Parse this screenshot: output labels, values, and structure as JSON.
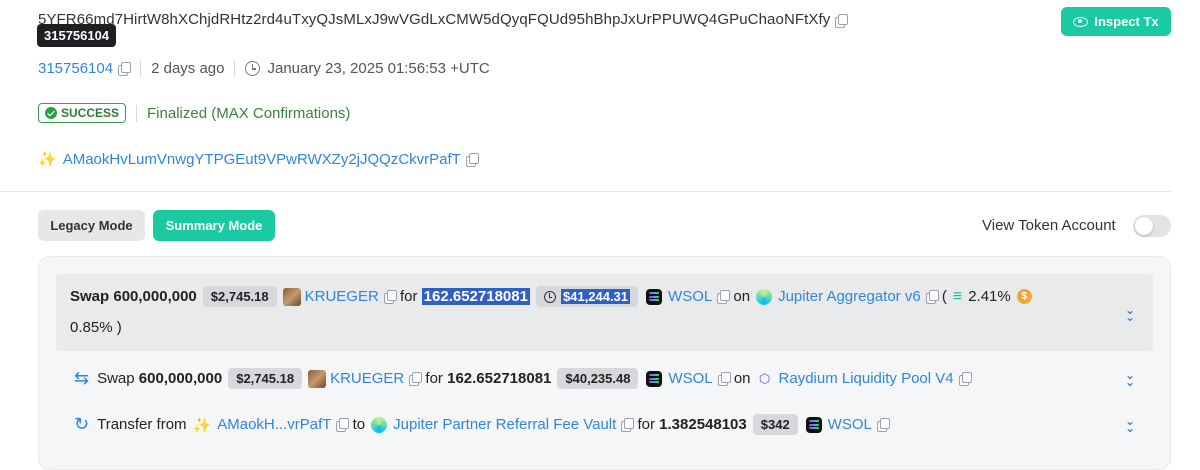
{
  "signature": "5YFR66md7HirtW8hXChjdRHtz2rd4uTxyQJsMLxJ9wVGdLxCMW5dQyqFQUd95hBhpJxUrPPUWQ4GPuChaoNFtXfy",
  "tooltip": "315756104",
  "inspect_label": "Inspect Tx",
  "block": "315756104",
  "relative_time": "2 days ago",
  "timestamp": "January 23, 2025 01:56:53 +UTC",
  "status": {
    "badge": "SUCCESS",
    "text": "Finalized (MAX Confirmations)"
  },
  "signer": "AMaokHvLumVnwgYTPGEut9VPwRWXZy2jJQQzCkvrPafT",
  "modes": {
    "legacy": "Legacy Mode",
    "summary": "Summary Mode"
  },
  "view_token_account": {
    "label": "View Token Account",
    "enabled": false
  },
  "actions": [
    {
      "verb": "Swap",
      "amount_in": "600,000,000",
      "value_in": "$2,745.18",
      "token_in": "KRUEGER",
      "for": "for",
      "amount_out": "162.652718081",
      "value_out": "$41,244.31",
      "token_out": "WSOL",
      "on": "on",
      "venue": "Jupiter Aggregator v6",
      "paren_open": "(",
      "fee1": "2.41%",
      "fee2": "0.85% )"
    },
    {
      "verb": "Swap",
      "amount_in": "600,000,000",
      "value_in": "$2,745.18",
      "token_in": "KRUEGER",
      "for": "for",
      "amount_out": "162.652718081",
      "value_out": "$40,235.48",
      "token_out": "WSOL",
      "on": "on",
      "venue": "Raydium Liquidity Pool V4"
    },
    {
      "verb": "Transfer from",
      "from": "AMaokH...vrPafT",
      "to_label": "to",
      "to": "Jupiter Partner Referral Fee Vault",
      "for": "for",
      "amount": "1.382548103",
      "value": "$342",
      "token": "WSOL"
    }
  ],
  "icons": {
    "copy": "copy-icon",
    "eye": "eye-icon",
    "clock": "clock-icon",
    "check": "check-circle-icon",
    "signer": "signer-icon",
    "swap": "swap-arrows-icon",
    "transfer": "transfer-icon",
    "expand": "chevron-double-down-icon"
  },
  "colors": {
    "accent": "#1bc9a3",
    "link": "#2f86d9",
    "success": "#2e7d32",
    "selection": "#3060c4"
  }
}
